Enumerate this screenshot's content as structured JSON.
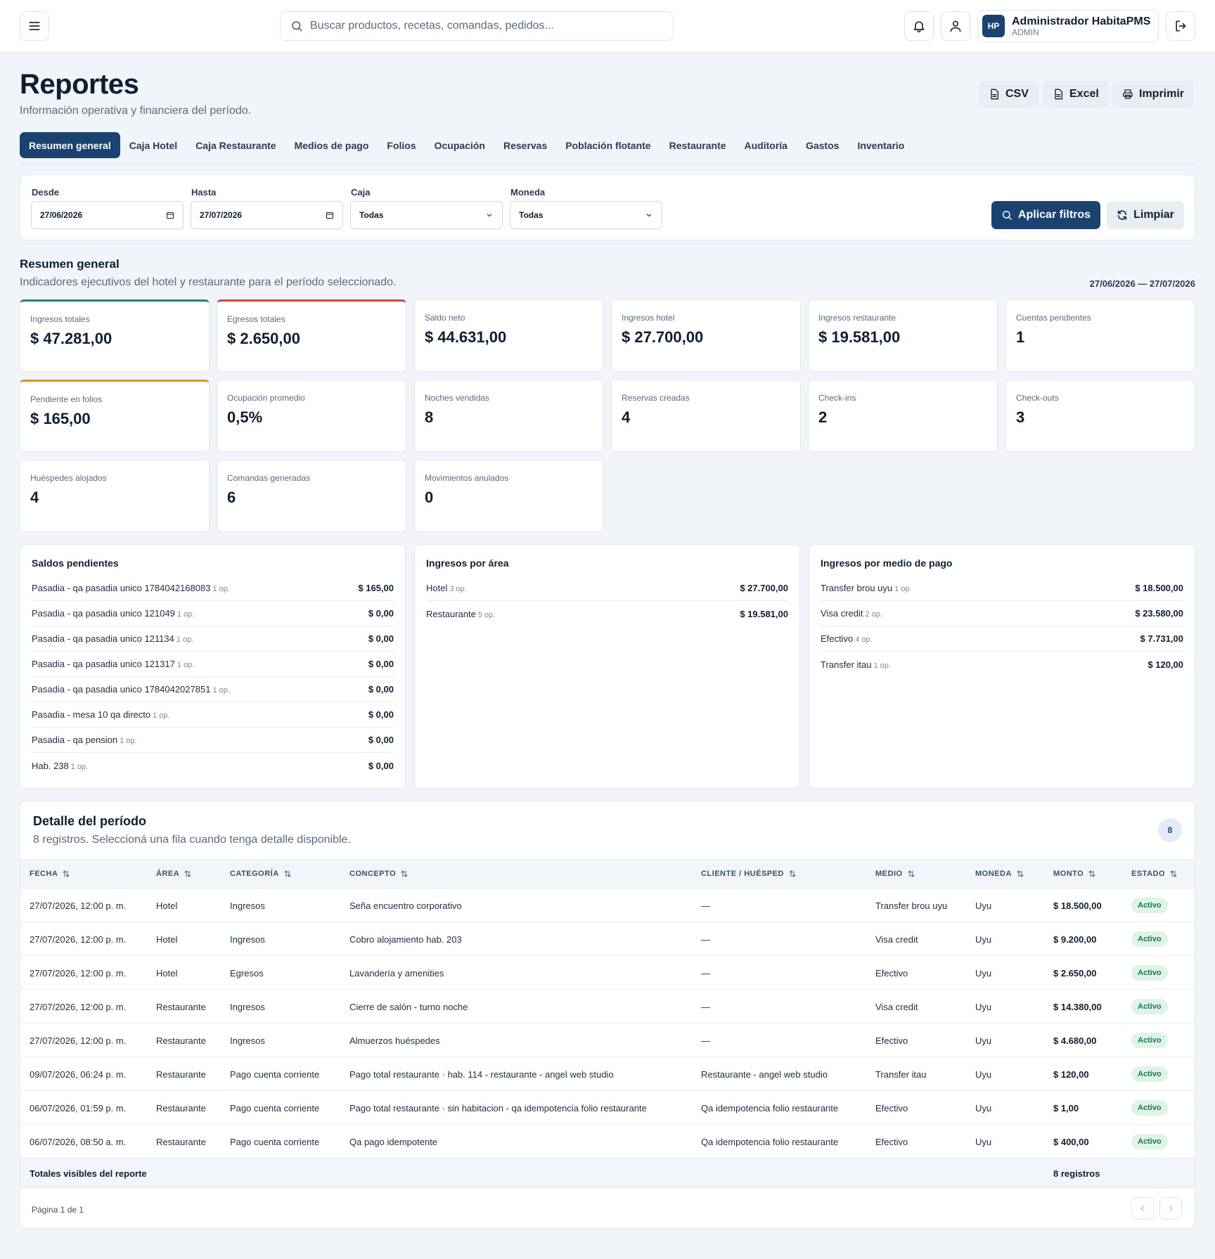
{
  "topbar": {
    "search_placeholder": "Buscar productos, recetas, comandas, pedidos...",
    "user": {
      "initials": "HP",
      "name": "Administrador HabitaPMS",
      "role": "ADMIN"
    }
  },
  "header": {
    "title": "Reportes",
    "subtitle": "Información operativa y financiera del período.",
    "exports": [
      "CSV",
      "Excel",
      "Imprimir"
    ]
  },
  "tabs": [
    "Resumen general",
    "Caja Hotel",
    "Caja Restaurante",
    "Medios de pago",
    "Folios",
    "Ocupación",
    "Reservas",
    "Población flotante",
    "Restaurante",
    "Auditoría",
    "Gastos",
    "Inventario"
  ],
  "filters": {
    "desde_label": "Desde",
    "desde_value": "27/06/2026",
    "hasta_label": "Hasta",
    "hasta_value": "27/07/2026",
    "caja_label": "Caja",
    "caja_value": "Todas",
    "moneda_label": "Moneda",
    "moneda_value": "Todas",
    "apply_label": "Aplicar filtros",
    "clear_label": "Limpiar"
  },
  "summary": {
    "title": "Resumen general",
    "subtitle": "Indicadores ejecutivos del hotel y restaurante para el período seleccionado.",
    "range": "27/06/2026 — 27/07/2026",
    "kpis": [
      {
        "label": "Ingresos totales",
        "value": "$ 47.281,00",
        "accent": "#1f8a5f"
      },
      {
        "label": "Egresos totales",
        "value": "$ 2.650,00",
        "accent": "#c94a3e"
      },
      {
        "label": "Saldo neto",
        "value": "$ 44.631,00"
      },
      {
        "label": "Ingresos hotel",
        "value": "$ 27.700,00"
      },
      {
        "label": "Ingresos restaurante",
        "value": "$ 19.581,00"
      },
      {
        "label": "Cuentas pendientes",
        "value": "1"
      },
      {
        "label": "Pendiente en folios",
        "value": "$ 165,00",
        "accent": "#d7922b"
      },
      {
        "label": "Ocupación promedio",
        "value": "0,5%"
      },
      {
        "label": "Noches vendidas",
        "value": "8"
      },
      {
        "label": "Reservas creadas",
        "value": "4"
      },
      {
        "label": "Check-ins",
        "value": "2"
      },
      {
        "label": "Check-outs",
        "value": "3"
      },
      {
        "label": "Huéspedes alojados",
        "value": "4"
      },
      {
        "label": "Comandas generadas",
        "value": "6"
      },
      {
        "label": "Movimientos anulados",
        "value": "0"
      }
    ]
  },
  "panels": {
    "saldos": {
      "title": "Saldos pendientes",
      "rows": [
        {
          "name": "Pasadia - qa pasadia unico 1784042168083",
          "ops": "1 op.",
          "amount": "$ 165,00"
        },
        {
          "name": "Pasadia - qa pasadia unico 121049",
          "ops": "1 op.",
          "amount": "$ 0,00"
        },
        {
          "name": "Pasadia - qa pasadia unico 121134",
          "ops": "1 op.",
          "amount": "$ 0,00"
        },
        {
          "name": "Pasadia - qa pasadia unico 121317",
          "ops": "1 op.",
          "amount": "$ 0,00"
        },
        {
          "name": "Pasadia - qa pasadia unico 1784042027851",
          "ops": "1 op.",
          "amount": "$ 0,00"
        },
        {
          "name": "Pasadia - mesa 10 qa directo",
          "ops": "1 op.",
          "amount": "$ 0,00"
        },
        {
          "name": "Pasadia - qa pension",
          "ops": "1 op.",
          "amount": "$ 0,00"
        },
        {
          "name": "Hab. 238",
          "ops": "1 op.",
          "amount": "$ 0,00"
        }
      ]
    },
    "area": {
      "title": "Ingresos por área",
      "rows": [
        {
          "name": "Hotel",
          "ops": "3 op.",
          "amount": "$ 27.700,00"
        },
        {
          "name": "Restaurante",
          "ops": "5 op.",
          "amount": "$ 19.581,00"
        }
      ]
    },
    "medio": {
      "title": "Ingresos por medio de pago",
      "rows": [
        {
          "name": "Transfer brou uyu",
          "ops": "1 op.",
          "amount": "$ 18.500,00"
        },
        {
          "name": "Visa credit",
          "ops": "2 op.",
          "amount": "$ 23.580,00"
        },
        {
          "name": "Efectivo",
          "ops": "4 op.",
          "amount": "$ 7.731,00"
        },
        {
          "name": "Transfer itau",
          "ops": "1 op.",
          "amount": "$ 120,00"
        }
      ]
    }
  },
  "detail": {
    "title": "Detalle del período",
    "subtitle": "8 registros. Seleccioná una fila cuando tenga detalle disponible.",
    "count": "8",
    "columns": [
      "FECHA",
      "ÁREA",
      "CATEGORÍA",
      "CONCEPTO",
      "CLIENTE / HUÉSPED",
      "MEDIO",
      "MONEDA",
      "MONTO",
      "ESTADO"
    ],
    "rows": [
      [
        "27/07/2026, 12:00 p. m.",
        "Hotel",
        "Ingresos",
        "Seña encuentro corporativo",
        "—",
        "Transfer brou uyu",
        "Uyu",
        "$ 18.500,00",
        "Activo"
      ],
      [
        "27/07/2026, 12:00 p. m.",
        "Hotel",
        "Ingresos",
        "Cobro alojamiento hab. 203",
        "—",
        "Visa credit",
        "Uyu",
        "$ 9.200,00",
        "Activo"
      ],
      [
        "27/07/2026, 12:00 p. m.",
        "Hotel",
        "Egresos",
        "Lavandería y amenities",
        "—",
        "Efectivo",
        "Uyu",
        "$ 2.650,00",
        "Activo"
      ],
      [
        "27/07/2026, 12:00 p. m.",
        "Restaurante",
        "Ingresos",
        "Cierre de salón - turno noche",
        "—",
        "Visa credit",
        "Uyu",
        "$ 14.380,00",
        "Activo"
      ],
      [
        "27/07/2026, 12:00 p. m.",
        "Restaurante",
        "Ingresos",
        "Almuerzos huéspedes",
        "—",
        "Efectivo",
        "Uyu",
        "$ 4.680,00",
        "Activo"
      ],
      [
        "09/07/2026, 06:24 p. m.",
        "Restaurante",
        "Pago cuenta corriente",
        "Pago total restaurante · hab. 114 - restaurante - angel web studio",
        "Restaurante - angel web studio",
        "Transfer itau",
        "Uyu",
        "$ 120,00",
        "Activo"
      ],
      [
        "06/07/2026, 01:59 p. m.",
        "Restaurante",
        "Pago cuenta corriente",
        "Pago total restaurante · sin habitacion - qa idempotencia folio restaurante",
        "Qa idempotencia folio restaurante",
        "Efectivo",
        "Uyu",
        "$ 1,00",
        "Activo"
      ],
      [
        "06/07/2026, 08:50 a. m.",
        "Restaurante",
        "Pago cuenta corriente",
        "Qa pago idempotente",
        "Qa idempotencia folio restaurante",
        "Efectivo",
        "Uyu",
        "$ 400,00",
        "Activo"
      ]
    ],
    "totals_label": "Totales visibles del reporte",
    "totals_value": "8 registros",
    "page_label": "Página 1 de 1"
  }
}
